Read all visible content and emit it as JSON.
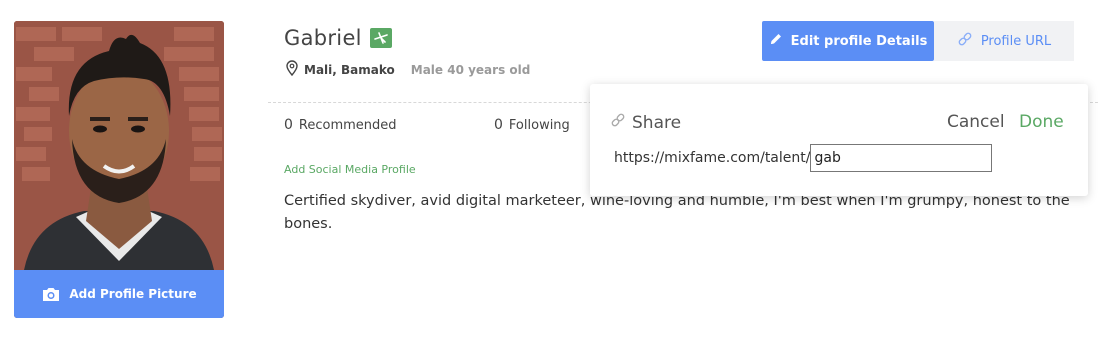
{
  "profile": {
    "name": "Gabriel",
    "location": "Mali, Bamako",
    "meta": "Male 40 years old",
    "add_picture_label": "Add Profile Picture",
    "add_social_label": "Add Social Media Profile",
    "bio": "Certified skydiver, avid digital marketeer, wine-loving and humble, I'm best when I'm grumpy, honest to the bones."
  },
  "actions": {
    "edit_label": "Edit profile Details",
    "url_label": "Profile URL"
  },
  "stats": [
    {
      "count": "0",
      "label": "Recommended"
    },
    {
      "count": "0",
      "label": "Following"
    }
  ],
  "share_popover": {
    "title": "Share",
    "cancel_label": "Cancel",
    "done_label": "Done",
    "url_prefix": "https://mixfame.com/talent/",
    "slug_value": "gab"
  },
  "colors": {
    "primary_blue": "#5b8ef5",
    "accent_green": "#5aa864",
    "secondary_bg": "#f1f2f4"
  },
  "icons": [
    "camera-icon",
    "verified-badge-icon",
    "location-pin-icon",
    "pencil-icon",
    "link-icon"
  ]
}
